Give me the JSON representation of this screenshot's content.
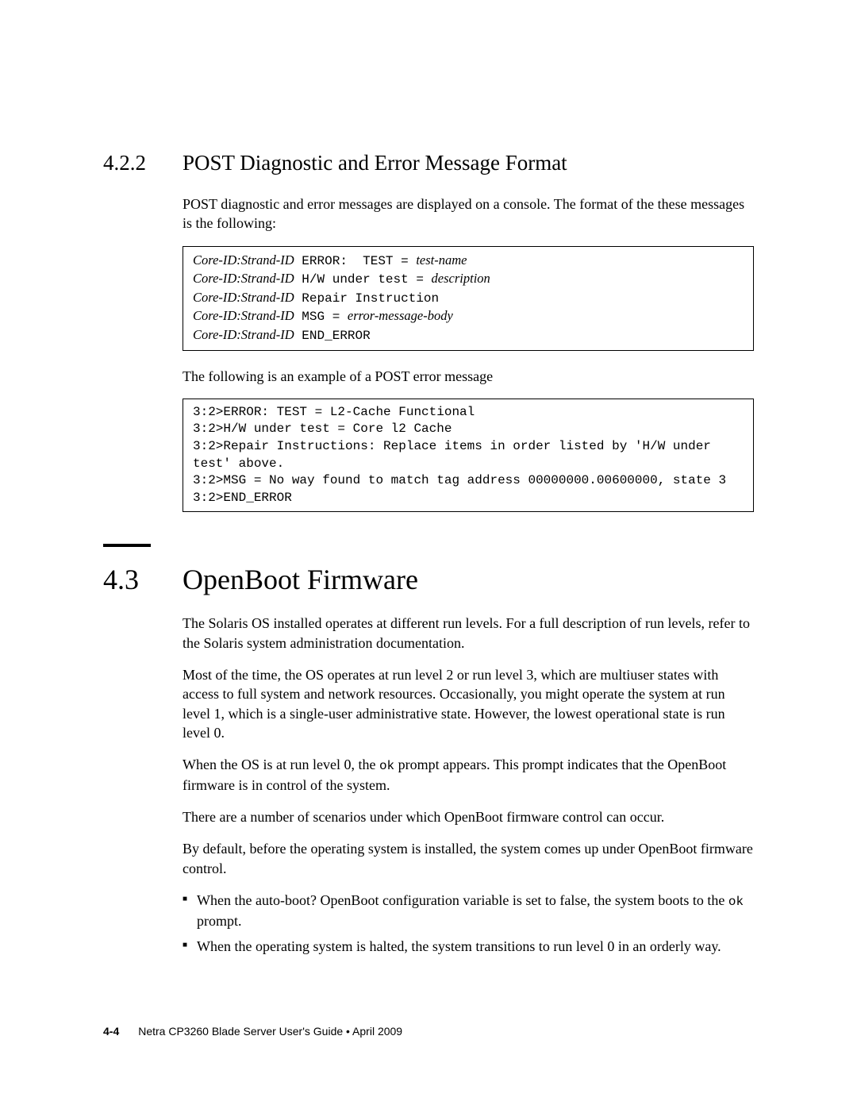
{
  "section422": {
    "num": "4.2.2",
    "title": "POST Diagnostic and Error Message Format",
    "intro": "POST diagnostic and error messages are displayed on a console. The format of the these messages is the following:",
    "format": {
      "l1_pre": "Core-ID:Strand-ID",
      "l1_mid": " ERROR:  TEST = ",
      "l1_var": "test-name",
      "l2_pre": "Core-ID:Strand-ID",
      "l2_mid": " H/W under test = ",
      "l2_var": "description",
      "l3_pre": "Core-ID:Strand-ID",
      "l3_mid": " Repair Instruction",
      "l4_pre": "Core-ID:Strand-ID",
      "l4_mid": " MSG = ",
      "l4_var": "error-message-body",
      "l5_pre": "Core-ID:Strand-ID",
      "l5_mid": " END_ERROR"
    },
    "example_intro": "The following is an example of a POST error message",
    "example": "3:2>ERROR: TEST = L2-Cache Functional\n3:2>H/W under test = Core l2 Cache\n3:2>Repair Instructions: Replace items in order listed by 'H/W under test' above.\n3:2>MSG = No way found to match tag address 00000000.00600000, state 3\n3:2>END_ERROR"
  },
  "section43": {
    "num": "4.3",
    "title": "OpenBoot Firmware",
    "p1": "The Solaris OS installed operates at different run levels. For a full description of run levels, refer to the Solaris system administration documentation.",
    "p2": "Most of the time, the OS operates at run level 2 or run level 3, which are multiuser states with access to full system and network resources. Occasionally, you might operate the system at run level 1, which is a single-user administrative state. However, the lowest operational state is run level 0.",
    "p3a": "When the OS is at run level 0, the ",
    "p3_code": "ok",
    "p3b": " prompt appears. This prompt indicates that the OpenBoot firmware is in control of the system.",
    "p4": "There are a number of scenarios under which OpenBoot firmware control can occur.",
    "p5": "By default, before the operating system is installed, the system comes up under OpenBoot firmware control.",
    "bullets": {
      "b1a": "When the auto-boot? OpenBoot configuration variable is set to false, the system boots to the ",
      "b1_code": "ok",
      "b1b": " prompt.",
      "b2": "When the operating system is halted, the system transitions to run level 0 in an orderly way."
    }
  },
  "footer": {
    "page": "4-4",
    "text": "Netra CP3260 Blade Server User's Guide  •  April 2009"
  }
}
